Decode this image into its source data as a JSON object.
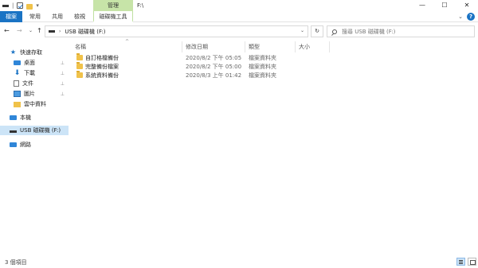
{
  "title_bar": {
    "path": "F:\\",
    "context_tab": "管理",
    "controls": {
      "minimize": "—",
      "maximize": "☐",
      "close": "✕"
    }
  },
  "ribbon": {
    "tabs": [
      {
        "label": "檔案",
        "active": true
      },
      {
        "label": "常用"
      },
      {
        "label": "共用"
      },
      {
        "label": "檢視"
      },
      {
        "label": "磁碟機工具"
      }
    ],
    "expand_glyph": "⌄",
    "help_glyph": "?"
  },
  "address_bar": {
    "back": "←",
    "forward": "→",
    "recent": "⌄",
    "up": "↑",
    "location": "USB 磁碟機 (F:)",
    "dropdown": "⌄",
    "refresh": "↻",
    "search_placeholder": "搜尋 USB 磁碟機 (F:)"
  },
  "nav_pane": {
    "items": [
      {
        "label": "快速存取",
        "icon": "star-icon"
      },
      {
        "label": "桌面",
        "icon": "desktop-icon",
        "pinned": true
      },
      {
        "label": "下載",
        "icon": "download-icon",
        "pinned": true
      },
      {
        "label": "文件",
        "icon": "document-icon",
        "pinned": true
      },
      {
        "label": "圖片",
        "icon": "pictures-icon",
        "pinned": true
      },
      {
        "label": "雲中資料",
        "icon": "folder-icon"
      },
      {
        "label": "本機",
        "icon": "computer-icon"
      },
      {
        "label": "USB 磁碟機 (F:)",
        "icon": "usb-drive-icon",
        "selected": true
      },
      {
        "label": "網路",
        "icon": "network-icon"
      }
    ],
    "pin_glyph": "📌"
  },
  "file_list": {
    "sort_glyph": "^",
    "columns": {
      "name": "名稱",
      "date": "修改日期",
      "type": "類型",
      "size": "大小"
    },
    "rows": [
      {
        "name": "自訂格檔備份",
        "date": "2020/8/2 下午 05:05",
        "type": "檔案資料夾"
      },
      {
        "name": "完整備份檔案",
        "date": "2020/8/2 下午 05:00",
        "type": "檔案資料夾"
      },
      {
        "name": "系統資料備份",
        "date": "2020/8/3 上午 01:42",
        "type": "檔案資料夾"
      }
    ]
  },
  "status_bar": {
    "item_count": "3 個項目"
  },
  "colors": {
    "accent": "#1a73c4",
    "manage_tab": "#c7e4a8",
    "selection": "#cce4f7",
    "folder": "#f0c24a"
  }
}
